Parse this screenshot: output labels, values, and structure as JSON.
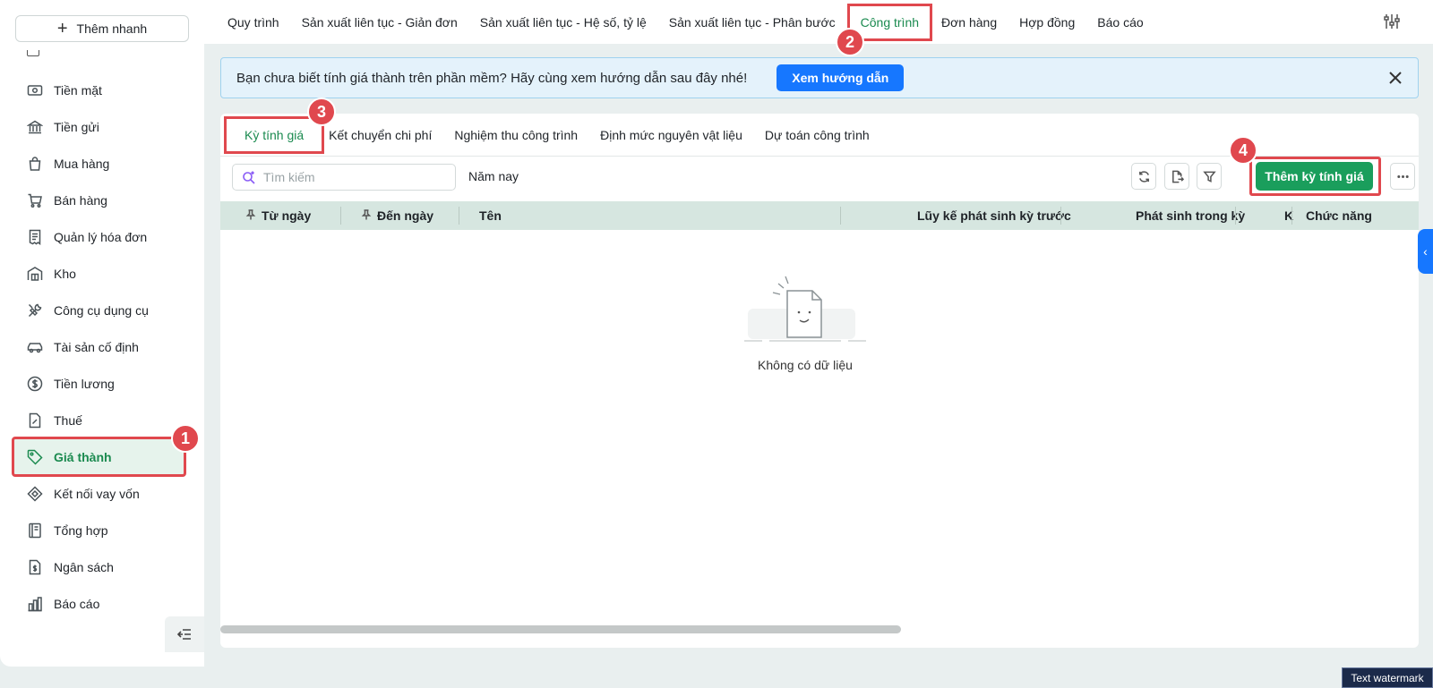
{
  "sidebar": {
    "quick_add_label": "Thêm nhanh",
    "items": [
      {
        "label": "Tiền mặt",
        "icon": "cash-icon"
      },
      {
        "label": "Tiền gửi",
        "icon": "bank-icon"
      },
      {
        "label": "Mua hàng",
        "icon": "shopping-bag-icon"
      },
      {
        "label": "Bán hàng",
        "icon": "cart-icon"
      },
      {
        "label": "Quản lý hóa đơn",
        "icon": "invoice-icon"
      },
      {
        "label": "Kho",
        "icon": "warehouse-icon"
      },
      {
        "label": "Công cụ dụng cụ",
        "icon": "tools-icon"
      },
      {
        "label": "Tài sản cố định",
        "icon": "car-icon"
      },
      {
        "label": "Tiền lương",
        "icon": "dollar-circle-icon"
      },
      {
        "label": "Thuế",
        "icon": "tax-document-icon"
      },
      {
        "label": "Giá thành",
        "icon": "price-tag-icon"
      },
      {
        "label": "Kết nối vay vốn",
        "icon": "loan-link-icon"
      },
      {
        "label": "Tổng hợp",
        "icon": "ledger-icon"
      },
      {
        "label": "Ngân sách",
        "icon": "budget-document-icon"
      },
      {
        "label": "Báo cáo",
        "icon": "bar-chart-icon"
      }
    ]
  },
  "topnav": {
    "tabs": [
      "Quy trình",
      "Sản xuất liên tục - Giản đơn",
      "Sản xuất liên tục - Hệ số, tỷ lệ",
      "Sản xuất liên tục - Phân bước",
      "Công trình",
      "Đơn hàng",
      "Hợp đồng",
      "Báo cáo"
    ]
  },
  "banner": {
    "text": "Bạn chưa biết tính giá thành trên phần mềm? Hãy cùng xem hướng dẫn sau đây nhé!",
    "button": "Xem hướng dẫn"
  },
  "subtabs": [
    "Kỳ tính giá",
    "Kết chuyển chi phí",
    "Nghiệm thu công trình",
    "Định mức nguyên vật liệu",
    "Dự toán công trình"
  ],
  "toolbar": {
    "search_placeholder": "Tìm kiếm",
    "period": "Năm nay",
    "add_button": "Thêm kỳ tính giá"
  },
  "table": {
    "columns": [
      "Từ ngày",
      "Đến ngày",
      "Tên",
      "Lũy kế phát sinh kỳ trước",
      "Phát sinh trong kỳ",
      "K",
      "Chức năng"
    ]
  },
  "empty_state": "Không có dữ liệu",
  "badges": [
    "1",
    "2",
    "3",
    "4"
  ],
  "watermark": "Text watermark",
  "colors": {
    "accent_green": "#1a8a4f",
    "primary_blue": "#1677ff",
    "highlight_red": "#e0484e"
  }
}
